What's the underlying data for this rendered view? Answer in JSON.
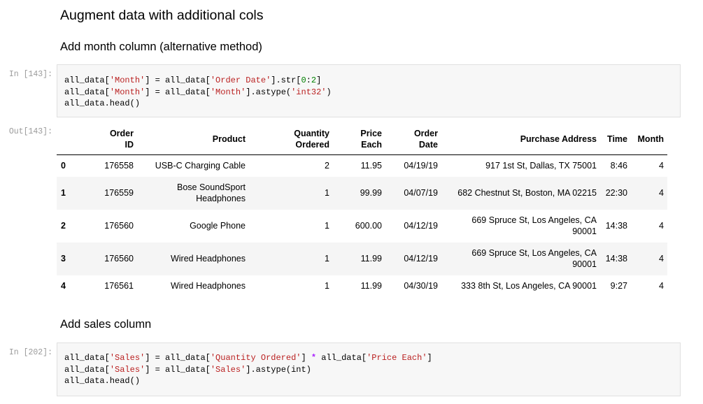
{
  "headings": {
    "main": "Augment data with additional cols",
    "month": "Add month column (alternative method)",
    "sales": "Add sales column"
  },
  "cells": [
    {
      "prompt": "In [143]:",
      "lines": [
        [
          {
            "t": "all_data[",
            "c": ""
          },
          {
            "t": "'Month'",
            "c": "s"
          },
          {
            "t": "] = all_data[",
            "c": ""
          },
          {
            "t": "'Order Date'",
            "c": "s"
          },
          {
            "t": "].str[",
            "c": ""
          },
          {
            "t": "0",
            "c": "n"
          },
          {
            "t": ":",
            "c": ""
          },
          {
            "t": "2",
            "c": "n"
          },
          {
            "t": "]",
            "c": ""
          }
        ],
        [
          {
            "t": "all_data[",
            "c": ""
          },
          {
            "t": "'Month'",
            "c": "s"
          },
          {
            "t": "] = all_data[",
            "c": ""
          },
          {
            "t": "'Month'",
            "c": "s"
          },
          {
            "t": "].astype(",
            "c": ""
          },
          {
            "t": "'int32'",
            "c": "s"
          },
          {
            "t": ")",
            "c": ""
          }
        ],
        [
          {
            "t": "all_data.head()",
            "c": ""
          }
        ]
      ]
    },
    {
      "prompt": "In [202]:",
      "lines": [
        [
          {
            "t": "all_data[",
            "c": ""
          },
          {
            "t": "'Sales'",
            "c": "s"
          },
          {
            "t": "] = all_data[",
            "c": ""
          },
          {
            "t": "'Quantity Ordered'",
            "c": "s"
          },
          {
            "t": "] ",
            "c": ""
          },
          {
            "t": "*",
            "c": "o"
          },
          {
            "t": " all_data[",
            "c": ""
          },
          {
            "t": "'Price Each'",
            "c": "s"
          },
          {
            "t": "]",
            "c": ""
          }
        ],
        [
          {
            "t": "all_data[",
            "c": ""
          },
          {
            "t": "'Sales'",
            "c": "s"
          },
          {
            "t": "] = all_data[",
            "c": ""
          },
          {
            "t": "'Sales'",
            "c": "s"
          },
          {
            "t": "].astype(int)",
            "c": ""
          }
        ],
        [
          {
            "t": "all_data.head()",
            "c": ""
          }
        ]
      ]
    }
  ],
  "output": {
    "prompt": "Out[143]:",
    "columns": [
      [
        "Order",
        "ID"
      ],
      [
        "Product"
      ],
      [
        "Quantity",
        "Ordered"
      ],
      [
        "Price",
        "Each"
      ],
      [
        "Order",
        "Date"
      ],
      [
        "Purchase Address"
      ],
      [
        "Time"
      ],
      [
        "Month"
      ]
    ],
    "rows": [
      {
        "index": "0",
        "cells": [
          [
            "176558"
          ],
          [
            "USB-C Charging Cable"
          ],
          [
            "2"
          ],
          [
            "11.95"
          ],
          [
            "04/19/19"
          ],
          [
            "917 1st St, Dallas, TX 75001"
          ],
          [
            "8:46"
          ],
          [
            "4"
          ]
        ]
      },
      {
        "index": "1",
        "cells": [
          [
            "176559"
          ],
          [
            "Bose SoundSport",
            "Headphones"
          ],
          [
            "1"
          ],
          [
            "99.99"
          ],
          [
            "04/07/19"
          ],
          [
            "682 Chestnut St, Boston, MA 02215"
          ],
          [
            "22:30"
          ],
          [
            "4"
          ]
        ]
      },
      {
        "index": "2",
        "cells": [
          [
            "176560"
          ],
          [
            "Google Phone"
          ],
          [
            "1"
          ],
          [
            "600.00"
          ],
          [
            "04/12/19"
          ],
          [
            "669 Spruce St, Los Angeles, CA",
            "90001"
          ],
          [
            "14:38"
          ],
          [
            "4"
          ]
        ]
      },
      {
        "index": "3",
        "cells": [
          [
            "176560"
          ],
          [
            "Wired Headphones"
          ],
          [
            "1"
          ],
          [
            "11.99"
          ],
          [
            "04/12/19"
          ],
          [
            "669 Spruce St, Los Angeles, CA",
            "90001"
          ],
          [
            "14:38"
          ],
          [
            "4"
          ]
        ]
      },
      {
        "index": "4",
        "cells": [
          [
            "176561"
          ],
          [
            "Wired Headphones"
          ],
          [
            "1"
          ],
          [
            "11.99"
          ],
          [
            "04/30/19"
          ],
          [
            "333 8th St, Los Angeles, CA 90001"
          ],
          [
            "9:27"
          ],
          [
            "4"
          ]
        ]
      }
    ]
  }
}
